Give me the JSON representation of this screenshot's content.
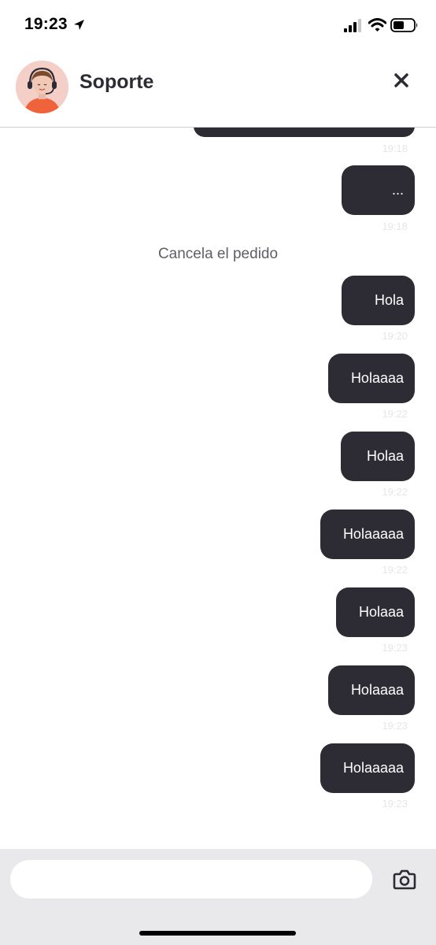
{
  "status_bar": {
    "time": "19:23"
  },
  "header": {
    "title": "Soporte"
  },
  "system_message": "Cancela el pedido",
  "messages": [
    {
      "text": "",
      "time": "19:18"
    },
    {
      "text": "...",
      "time": "19:18"
    },
    {
      "text": "Hola",
      "time": "19:20"
    },
    {
      "text": "Holaaaa",
      "time": "19:22"
    },
    {
      "text": "Holaa",
      "time": "19:22"
    },
    {
      "text": "Holaaaaa",
      "time": "19:22"
    },
    {
      "text": "Holaaa",
      "time": "19:23"
    },
    {
      "text": "Holaaaa",
      "time": "19:23"
    },
    {
      "text": "Holaaaaa",
      "time": "19:23"
    }
  ],
  "composer": {
    "value": "",
    "placeholder": ""
  },
  "icons": [
    "location-arrow-icon",
    "signal-icon",
    "wifi-icon",
    "battery-icon",
    "close-icon",
    "camera-icon"
  ],
  "colors": {
    "bubble": "#2d2c35",
    "footer": "#e9e9eb",
    "avatar_bg": "#f4cfc7",
    "avatar_shirt": "#f0623a"
  }
}
